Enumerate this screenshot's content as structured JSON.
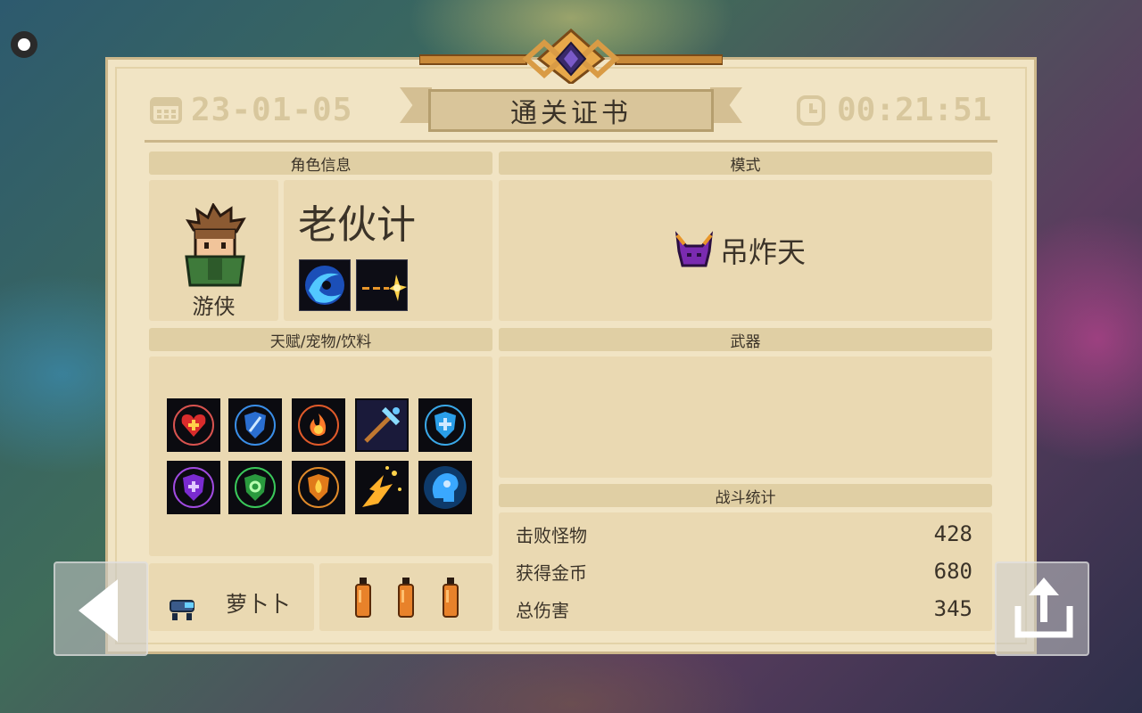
{
  "header": {
    "title": "通关证书",
    "date": "23-01-05",
    "time": "00:21:51"
  },
  "character": {
    "section_label": "角色信息",
    "name": "老伙计",
    "class": "游侠",
    "skills": [
      "water-swirl-skill-icon",
      "spark-shot-skill-icon"
    ]
  },
  "mode": {
    "section_label": "模式",
    "name": "吊炸天",
    "icon": "horned-demon-icon"
  },
  "talents": {
    "section_label": "天赋/宠物/饮料",
    "icons": [
      "heart-plus-talent-icon",
      "blue-shield-slash-talent-icon",
      "fire-swirl-talent-icon",
      "pickaxe-talent-icon",
      "shield-cross-talent-icon",
      "purple-shield-talent-icon",
      "green-shield-talent-icon",
      "orange-shield-talent-icon",
      "explosion-talent-icon",
      "brain-talent-icon"
    ]
  },
  "pet": {
    "name": "萝卜卜",
    "icon": "robot-pet-icon"
  },
  "drinks": {
    "count": 3,
    "icon": "orange-bottle-icon"
  },
  "weapons": {
    "section_label": "武器"
  },
  "battle_stats": {
    "section_label": "战斗统计",
    "rows": [
      {
        "label": "击败怪物",
        "value": "428"
      },
      {
        "label": "获得金币",
        "value": "680"
      },
      {
        "label": "总伤害",
        "value": "345"
      }
    ]
  },
  "colors": {
    "card_bg": "#f1e4c4",
    "panel_bg": "#ead9b2",
    "header_bg": "#e0cfa4",
    "text": "#3b3328",
    "accent_gold": "#d8c79d"
  }
}
